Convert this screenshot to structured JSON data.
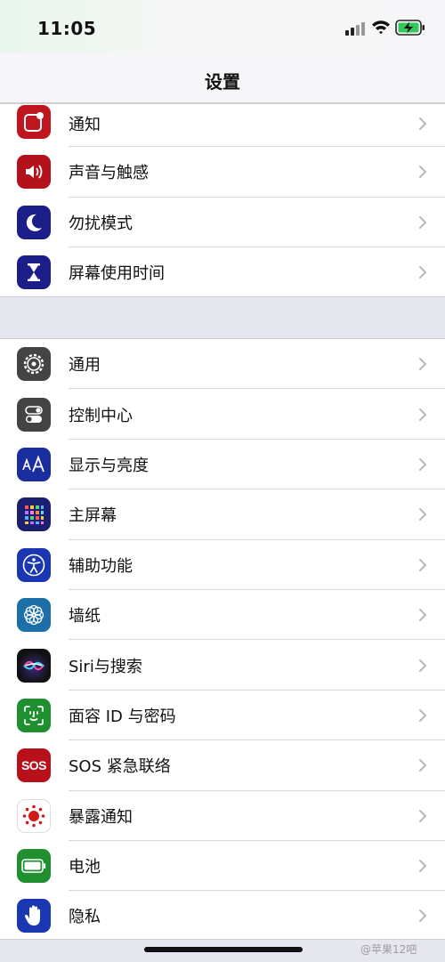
{
  "status_bar": {
    "time": "11:05"
  },
  "nav": {
    "title": "设置"
  },
  "colors": {
    "chevron": "#b8b8bd"
  },
  "groups": [
    {
      "items": [
        {
          "label": "通知",
          "icon": "notifications-icon",
          "color": "#c0141f"
        },
        {
          "label": "声音与触感",
          "icon": "sound-icon",
          "color": "#b3111b"
        },
        {
          "label": "勿扰模式",
          "icon": "moon-icon",
          "color": "#1b1e88"
        },
        {
          "label": "屏幕使用时间",
          "icon": "hourglass-icon",
          "color": "#1b1e88"
        }
      ]
    },
    {
      "items": [
        {
          "label": "通用",
          "icon": "gear-icon",
          "color": "#444444"
        },
        {
          "label": "控制中心",
          "icon": "toggles-icon",
          "color": "#444444"
        },
        {
          "label": "显示与亮度",
          "icon": "text-size-icon",
          "color": "#1a2ea0"
        },
        {
          "label": "主屏幕",
          "icon": "home-grid-icon",
          "color": "#1a1f72"
        },
        {
          "label": "辅助功能",
          "icon": "accessibility-icon",
          "color": "#1a36b0"
        },
        {
          "label": "墙纸",
          "icon": "wallpaper-flower-icon",
          "color": "#1d6fa8"
        },
        {
          "label": "Siri与搜索",
          "icon": "siri-icon",
          "color": "#111111"
        },
        {
          "label": "面容 ID 与密码",
          "icon": "face-id-icon",
          "color": "#1f8f2f"
        },
        {
          "label": "SOS 紧急联络",
          "icon": "sos-icon",
          "color": "#b8111b",
          "icon_text": "SOS"
        },
        {
          "label": "暴露通知",
          "icon": "exposure-icon",
          "color": "#ffffff"
        },
        {
          "label": "电池",
          "icon": "battery-icon",
          "color": "#1f8f2f"
        },
        {
          "label": "隐私",
          "icon": "hand-icon",
          "color": "#1a36b0"
        }
      ]
    }
  ],
  "watermark": "@苹果12吧"
}
